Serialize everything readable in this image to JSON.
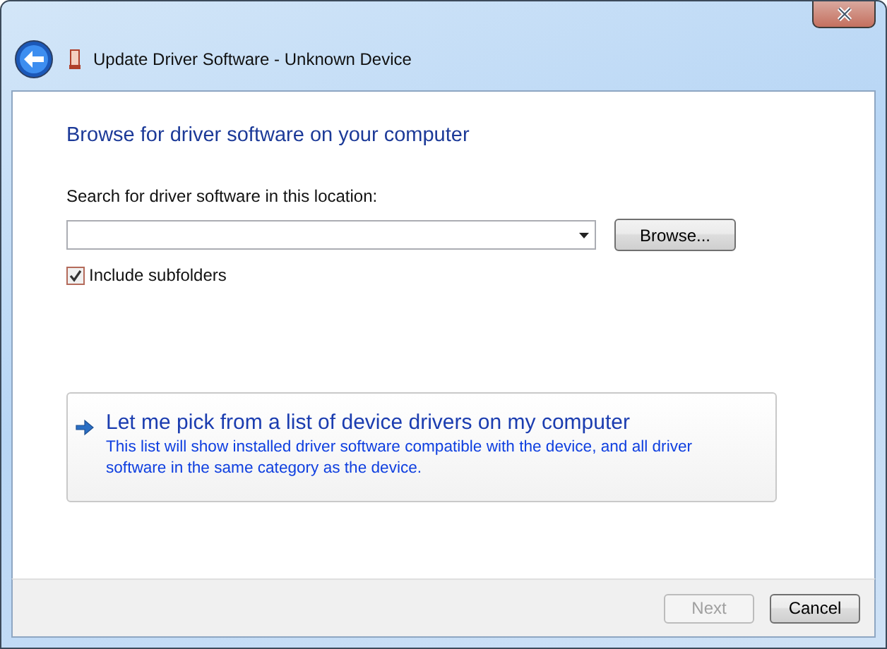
{
  "window": {
    "title": "Update Driver Software - Unknown Device"
  },
  "heading": "Browse for driver software on your computer",
  "location": {
    "label": "Search for driver software in this location:",
    "browse": "Browse..."
  },
  "include_subfolders": {
    "label": "Include subfolders",
    "checked": true
  },
  "option": {
    "title": "Let me pick from a list of device drivers on my computer",
    "description": "This list will show installed driver software compatible with the device, and all driver software in the same category as the device."
  },
  "buttons": [
    {
      "label": "Next",
      "disabled": true
    },
    {
      "label": "Cancel",
      "disabled": false
    }
  ]
}
